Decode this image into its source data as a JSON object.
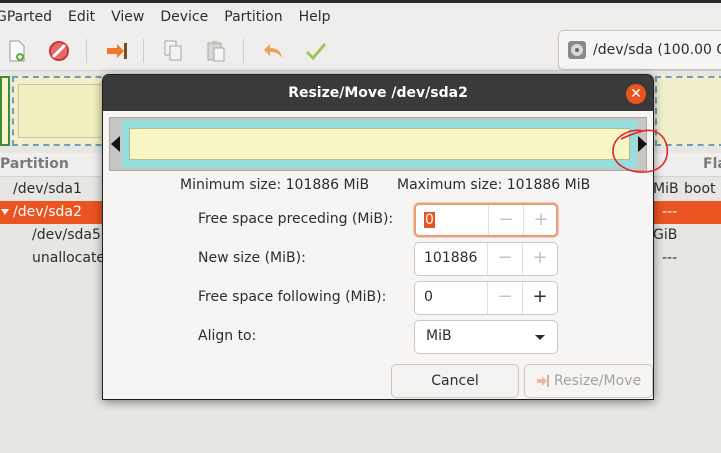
{
  "menubar": {
    "items": [
      "GParted",
      "Edit",
      "View",
      "Device",
      "Partition",
      "Help"
    ]
  },
  "toolbar": {
    "icons": [
      "new-icon",
      "delete-icon",
      "resize-move-icon",
      "copy-icon",
      "paste-icon",
      "undo-icon",
      "apply-icon"
    ],
    "device_label": "/dev/sda (100.00 G"
  },
  "partition_list": {
    "header_partition": "Partition",
    "header_flags": "Fla",
    "rows": [
      {
        "name": "/dev/sda1",
        "col_a": "MiB",
        "col_b": "boot"
      },
      {
        "name": "/dev/sda2",
        "col_a": "",
        "col_b": "---"
      },
      {
        "name": "/dev/sda5",
        "col_a": "GiB",
        "col_b": ""
      },
      {
        "name": "unallocate",
        "col_a": "",
        "col_b": "---"
      }
    ]
  },
  "dialog": {
    "title": "Resize/Move /dev/sda2",
    "min_size": "Minimum size: 101886 MiB",
    "max_size": "Maximum size: 101886 MiB",
    "fields": {
      "preceding_label": "Free space preceding (MiB):",
      "preceding_value": "0",
      "new_size_label": "New size (MiB):",
      "new_size_value": "101886",
      "following_label": "Free space following (MiB):",
      "following_value": "0",
      "align_label": "Align to:",
      "align_value": "MiB"
    },
    "buttons": {
      "cancel": "Cancel",
      "resize_move": "Resize/Move"
    }
  },
  "colors": {
    "accent": "#e95420",
    "titlebar": "#3a3a3a",
    "partition_fill": "#f7f7c3",
    "partition_border": "#96dede",
    "annotation": "#e3222a"
  }
}
